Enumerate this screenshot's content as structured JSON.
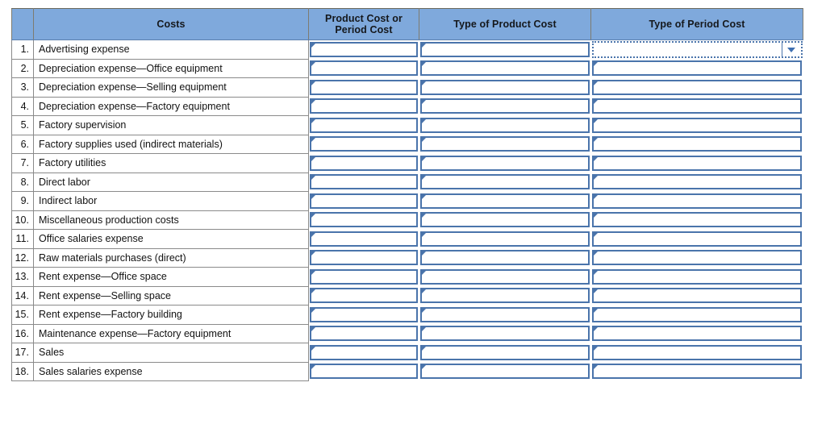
{
  "table": {
    "name": "classification-of-costs-worksheet",
    "headers": {
      "number": "",
      "costs": "Costs",
      "product_or_period": {
        "line1": "Product Cost or",
        "line2": "Period Cost"
      },
      "type_of_product_cost": "Type of Product Cost",
      "type_of_period_cost": "Type of Period Cost"
    },
    "rows": [
      {
        "num": "1.",
        "label": "Advertising expense",
        "product_or_period": "",
        "type_of_product_cost": "",
        "type_of_period_cost": ""
      },
      {
        "num": "2.",
        "label": "Depreciation expense—Office equipment",
        "product_or_period": "",
        "type_of_product_cost": "",
        "type_of_period_cost": ""
      },
      {
        "num": "3.",
        "label": "Depreciation expense—Selling equipment",
        "product_or_period": "",
        "type_of_product_cost": "",
        "type_of_period_cost": ""
      },
      {
        "num": "4.",
        "label": "Depreciation expense—Factory equipment",
        "product_or_period": "",
        "type_of_product_cost": "",
        "type_of_period_cost": ""
      },
      {
        "num": "5.",
        "label": "Factory supervision",
        "product_or_period": "",
        "type_of_product_cost": "",
        "type_of_period_cost": ""
      },
      {
        "num": "6.",
        "label": "Factory supplies used (indirect materials)",
        "product_or_period": "",
        "type_of_product_cost": "",
        "type_of_period_cost": ""
      },
      {
        "num": "7.",
        "label": "Factory utilities",
        "product_or_period": "",
        "type_of_product_cost": "",
        "type_of_period_cost": ""
      },
      {
        "num": "8.",
        "label": "Direct labor",
        "product_or_period": "",
        "type_of_product_cost": "",
        "type_of_period_cost": ""
      },
      {
        "num": "9.",
        "label": "Indirect labor",
        "product_or_period": "",
        "type_of_product_cost": "",
        "type_of_period_cost": ""
      },
      {
        "num": "10.",
        "label": "Miscellaneous production costs",
        "product_or_period": "",
        "type_of_product_cost": "",
        "type_of_period_cost": ""
      },
      {
        "num": "11.",
        "label": "Office salaries expense",
        "product_or_period": "",
        "type_of_product_cost": "",
        "type_of_period_cost": ""
      },
      {
        "num": "12.",
        "label": "Raw materials purchases (direct)",
        "product_or_period": "",
        "type_of_product_cost": "",
        "type_of_period_cost": ""
      },
      {
        "num": "13.",
        "label": "Rent expense—Office space",
        "product_or_period": "",
        "type_of_product_cost": "",
        "type_of_period_cost": ""
      },
      {
        "num": "14.",
        "label": "Rent expense—Selling space",
        "product_or_period": "",
        "type_of_product_cost": "",
        "type_of_period_cost": ""
      },
      {
        "num": "15.",
        "label": "Rent expense—Factory building",
        "product_or_period": "",
        "type_of_product_cost": "",
        "type_of_period_cost": ""
      },
      {
        "num": "16.",
        "label": "Maintenance expense—Factory equipment",
        "product_or_period": "",
        "type_of_product_cost": "",
        "type_of_period_cost": ""
      },
      {
        "num": "17.",
        "label": "Sales",
        "product_or_period": "",
        "type_of_product_cost": "",
        "type_of_period_cost": ""
      },
      {
        "num": "18.",
        "label": "Sales salaries expense",
        "product_or_period": "",
        "type_of_product_cost": "",
        "type_of_period_cost": ""
      }
    ],
    "selected_cell": {
      "row": 1,
      "column": "type_of_period_cost",
      "value": "",
      "icon": "chevron-down-icon"
    }
  },
  "colors": {
    "header_fill": "#7FA9DC",
    "entry_border": "#4a74ab",
    "grid_line": "#8a8a8a",
    "header_border": "#7e7b70",
    "text": "#121212",
    "page_background": "#ffffff"
  }
}
